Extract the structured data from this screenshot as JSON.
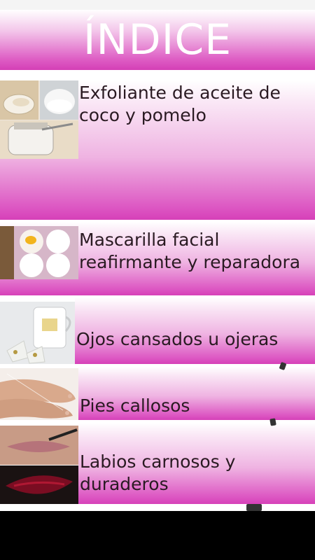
{
  "header": {
    "title": "ÍNDICE"
  },
  "items": [
    {
      "label": "Exfoliante de aceite de coco y pomelo"
    },
    {
      "label": "Mascarilla facial reafirmante y reparadora"
    },
    {
      "label": "Ojos cansados u ojeras"
    },
    {
      "label": "Pies callosos"
    },
    {
      "label": "Labios carnosos y duraderos"
    }
  ],
  "icons": [
    "coconut-oil-jar-photo",
    "eggs-carton-photo",
    "tea-bags-cup-photo",
    "feet-photo",
    "lips-photo"
  ],
  "colors": {
    "accent": "#d43fb6",
    "text": "#2a1a22"
  }
}
